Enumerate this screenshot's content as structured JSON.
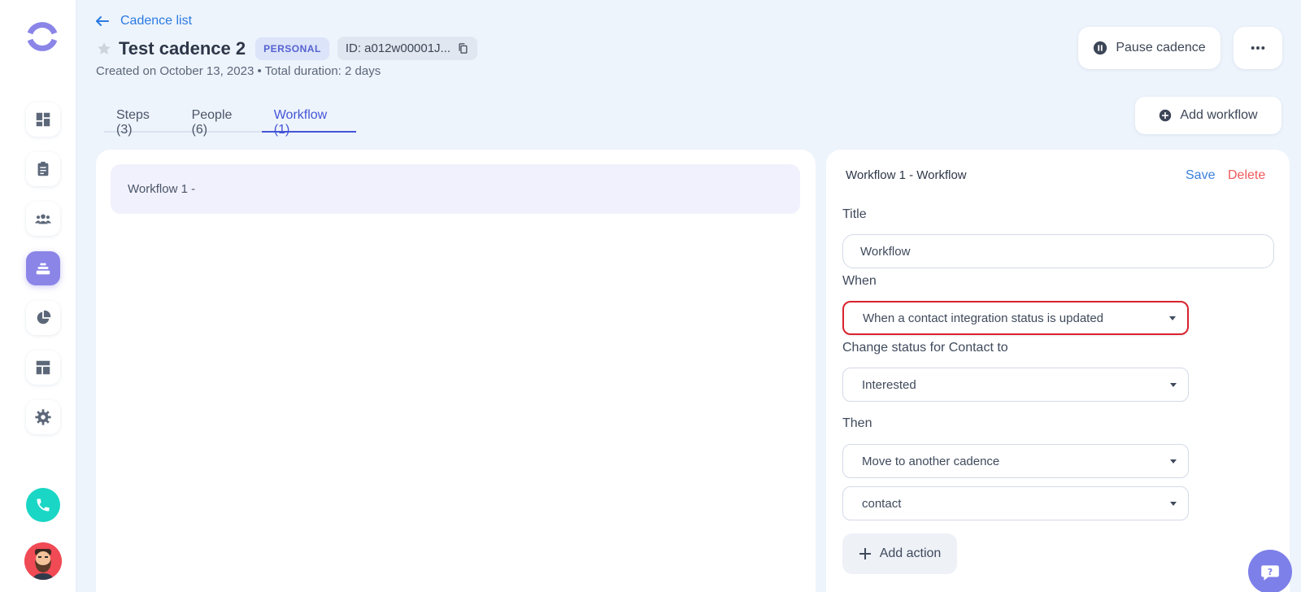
{
  "header": {
    "back_label": "Cadence list",
    "title": "Test cadence 2",
    "badge": "PERSONAL",
    "id_label": "ID: a012w00001J...",
    "subtitle": "Created on October 13, 2023 • Total duration: 2 days",
    "pause_label": "Pause cadence",
    "more_label": "..."
  },
  "tabs": [
    {
      "label": "Steps (3)"
    },
    {
      "label": "People (6)"
    },
    {
      "label": "Workflow (1)"
    }
  ],
  "add_workflow_label": "Add workflow",
  "workflow_list": [
    {
      "label": "Workflow 1 -"
    }
  ],
  "editor": {
    "heading": "Workflow 1 - Workflow",
    "save_label": "Save",
    "delete_label": "Delete",
    "title_label": "Title",
    "title_value": "Workflow",
    "when_label": "When",
    "when_value": "When a contact integration status is updated",
    "change_status_label": "Change status for Contact to",
    "change_status_value": "Interested",
    "then_label": "Then",
    "then_action_value": "Move to another cadence",
    "then_target_value": "contact",
    "add_action_label": "Add action"
  },
  "colors": {
    "accent": "#4455d6",
    "link": "#2a7ae2",
    "danger": "#ef5a5a",
    "highlight_border": "#d9232e",
    "active_nav": "#8b85e8",
    "phone": "#1ad6c5",
    "help": "#7d80e8"
  },
  "icons": {
    "logo": "logo-ring-icon",
    "nav": [
      "dashboard-icon",
      "clipboard-icon",
      "people-icon",
      "cadence-stack-icon",
      "pie-chart-icon",
      "layout-icon",
      "gear-icon"
    ],
    "phone": "phone-icon",
    "help": "chat-help-icon"
  }
}
